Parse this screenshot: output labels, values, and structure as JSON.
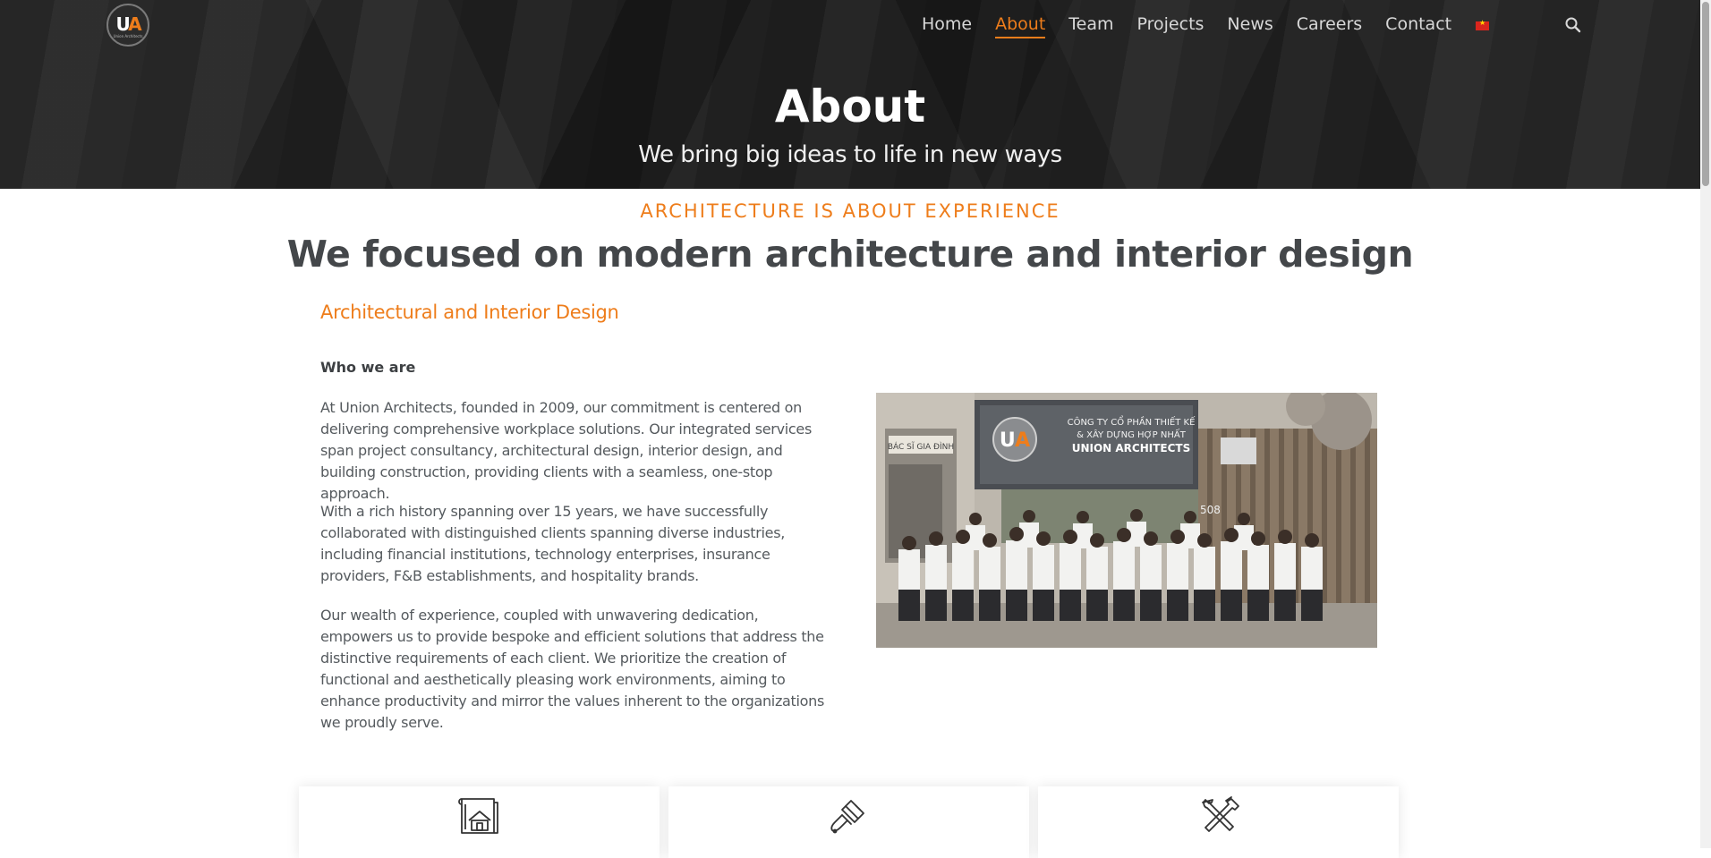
{
  "header": {
    "logo_text_u": "U",
    "logo_text_a": "A",
    "logo_subtext": "Union Architects",
    "nav": [
      {
        "label": "Home",
        "active": false
      },
      {
        "label": "About",
        "active": true
      },
      {
        "label": "Team",
        "active": false
      },
      {
        "label": "Projects",
        "active": false
      },
      {
        "label": "News",
        "active": false
      },
      {
        "label": "Careers",
        "active": false
      },
      {
        "label": "Contact",
        "active": false
      }
    ],
    "language_flag": "vietnam-flag-icon",
    "search_icon": "search-icon"
  },
  "hero": {
    "title": "About",
    "subtitle": "We bring big ideas to life in new ways"
  },
  "main": {
    "kicker": "ARCHITECTURE IS ABOUT EXPERIENCE",
    "headline": "We focused on modern architecture and interior design",
    "section_title": "Architectural and Interior Design",
    "who_we_are": "Who we are",
    "paragraphs": [
      "At Union Architects, founded in 2009, our commitment is centered on delivering comprehensive workplace solutions. Our integrated services span project consultancy, architectural design, interior design, and building construction, providing clients with a seamless, one-stop approach.",
      "With a rich history spanning over 15 years, we have successfully collaborated with distinguished clients spanning diverse industries, including financial institutions, technology enterprises, insurance providers, F&B establishments, and hospitality brands.",
      "Our wealth of experience, coupled with unwavering dedication, empowers us to provide bespoke and efficient solutions that address the distinctive requirements of each client. We prioritize the creation of functional and aesthetically pleasing work environments, aiming to enhance productivity and mirror the values inherent to the organizations we proudly serve."
    ],
    "photo": {
      "sign_line1": "CÔNG TY CỔ PHẦN THIẾT KẾ",
      "sign_line2": "& XÂY DỰNG HỢP NHẤT",
      "sign_line3": "UNION ARCHITECTS",
      "street_sign": "BÁC SĨ GIA ĐÌNH",
      "house_number": "508"
    }
  },
  "services": [
    {
      "icon": "blueprint-house-icon"
    },
    {
      "icon": "paint-brush-icon"
    },
    {
      "icon": "hammer-wrench-icon"
    }
  ],
  "colors": {
    "accent": "#ee7d1b",
    "hero_bg": "#222222",
    "heading": "#44474a",
    "body_text": "#555a5e"
  }
}
